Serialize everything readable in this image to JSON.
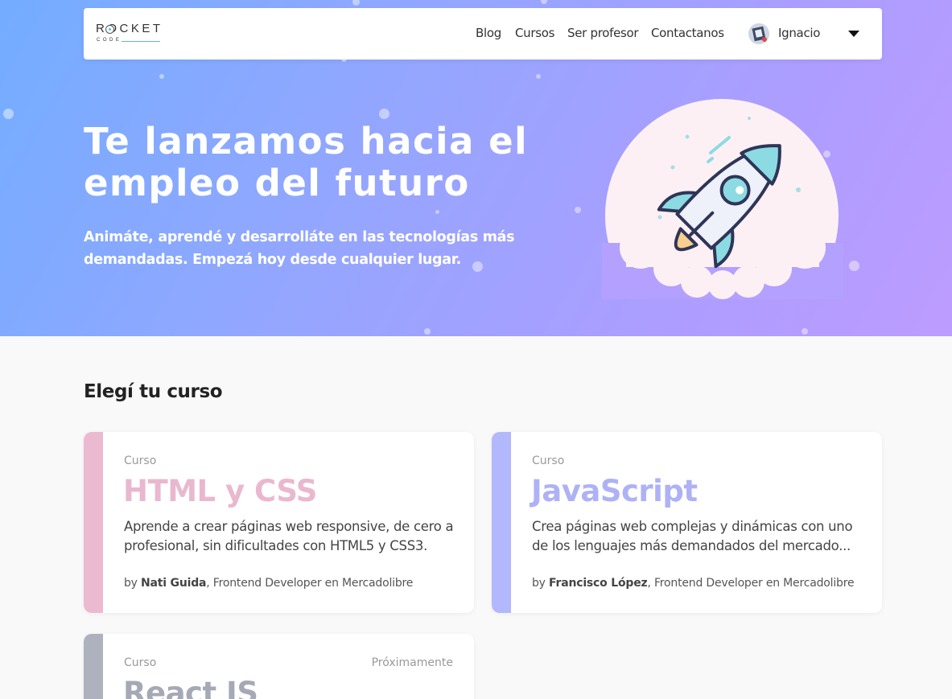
{
  "navbar": {
    "logo_top": "ROCKET",
    "logo_bottom": "CODE",
    "links": [
      "Blog",
      "Cursos",
      "Ser profesor",
      "Contactanos"
    ],
    "user_name": "Ignacio"
  },
  "hero": {
    "title": "Te lanzamos hacia el empleo del futuro",
    "subtitle": "Animáte, aprendé y desarrolláte en las tecnologías más demandadas. Empezá hoy desde cualquier lugar."
  },
  "courses_section": {
    "title": "Elegí tu curso",
    "cards": [
      {
        "kicker": "Curso",
        "title": "HTML y CSS",
        "description": "Aprende a crear páginas web responsive, de cero a profesional, sin dificultades con HTML5 y CSS3.",
        "author_prefix": "by ",
        "author_name": "Nati Guida",
        "author_role": ", Frontend Developer en Mercadolibre",
        "accent": "#ecbad0"
      },
      {
        "kicker": "Curso",
        "title": "JavaScript",
        "description": "Crea páginas web complejas y dinámicas con uno de los lenguajes más demandados del mercado...",
        "author_prefix": "by ",
        "author_name": "Francisco López",
        "author_role": ", Frontend Developer en Mercadolibre",
        "accent": "#b3b7fb"
      },
      {
        "kicker": "Curso",
        "status": "Próximamente",
        "title": "React JS",
        "accent": "#aeb2bf"
      }
    ]
  },
  "colors": {
    "hero_start": "#73adff",
    "hero_end": "#bd9cff",
    "html_title": "#e9b8cf",
    "js_title": "#aeb2f5",
    "react_title": "#a5a9b5"
  }
}
